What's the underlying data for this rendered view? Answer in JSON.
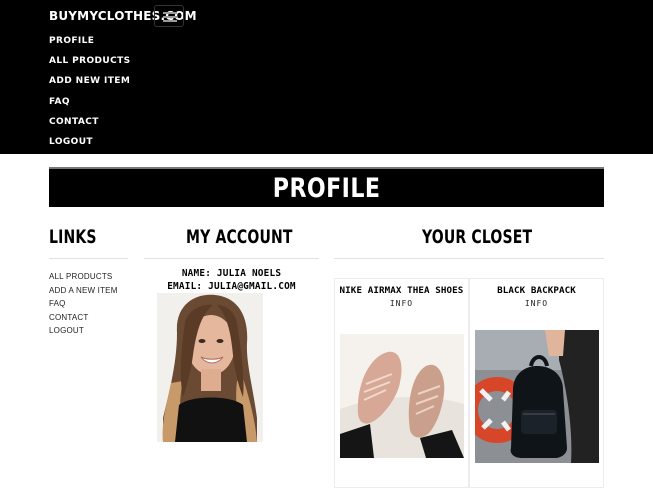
{
  "navbar": {
    "brand": "BUYMYCLOTHES.COM",
    "items": [
      {
        "label": "PROFILE"
      },
      {
        "label": "ALL PRODUCTS"
      },
      {
        "label": "ADD NEW ITEM"
      },
      {
        "label": "FAQ"
      },
      {
        "label": "CONTACT"
      },
      {
        "label": "LOGOUT"
      }
    ]
  },
  "banner": {
    "title": "PROFILE"
  },
  "links": {
    "heading": "LINKS",
    "items": [
      {
        "label": "ALL PRODUCTS"
      },
      {
        "label": "ADD A NEW ITEM"
      },
      {
        "label": "FAQ"
      },
      {
        "label": "CONTACT"
      },
      {
        "label": "LOGOUT"
      }
    ]
  },
  "account": {
    "heading": "MY ACCOUNT",
    "name_line": "NAME: JULIA NOELS",
    "email_line": "EMAIL: JULIA@GMAIL.COM"
  },
  "closet": {
    "heading": "YOUR CLOSET",
    "items": [
      {
        "title": "NIKE AIRMAX THEA SHOES",
        "info": "INFO"
      },
      {
        "title": "BLACK BACKPACK",
        "info": "INFO"
      }
    ]
  },
  "icons": [
    "menu-toggle-icon"
  ],
  "colors": {
    "nav_bg": "#000000",
    "nav_text": "#ffffff",
    "banner_bg": "#000000"
  }
}
